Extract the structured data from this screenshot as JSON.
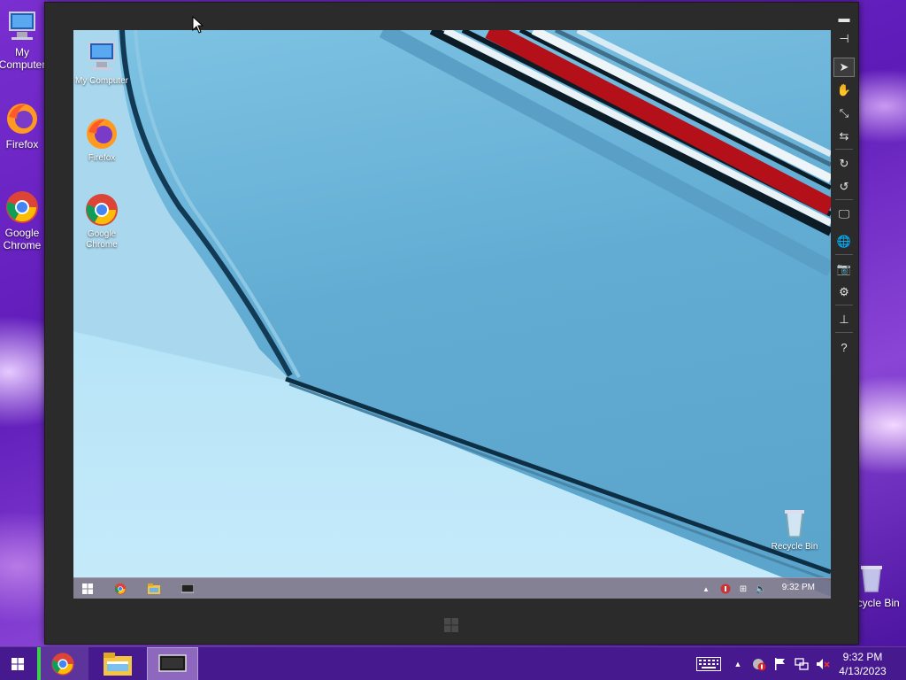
{
  "host": {
    "desktop_icons": [
      {
        "label": "My Computer",
        "icon": "computer-icon"
      },
      {
        "label": "Firefox",
        "icon": "firefox-icon"
      },
      {
        "label": "Google Chrome",
        "icon": "chrome-icon"
      },
      {
        "label": "Recycle Bin",
        "icon": "recycle-bin-icon"
      }
    ],
    "taskbar": {
      "apps": [
        {
          "name": "Google Chrome",
          "icon": "chrome-icon"
        },
        {
          "name": "File Explorer",
          "icon": "folder-icon"
        },
        {
          "name": "Remote Viewer",
          "icon": "monitor-icon"
        }
      ],
      "tray_icons": [
        "keyboard-icon",
        "show-hidden-icons-arrow",
        "security-icon",
        "flag-icon",
        "network-icon",
        "volume-muted-icon"
      ],
      "time": "9:32 PM",
      "date": "4/13/2023"
    }
  },
  "viewer": {
    "toolbar": [
      {
        "name": "minimize",
        "icon": "minimize-icon",
        "glyph": "▬"
      },
      {
        "name": "pin",
        "icon": "pin-icon",
        "glyph": "⊣"
      },
      {
        "name": "select",
        "icon": "cursor-icon",
        "glyph": "➤"
      },
      {
        "name": "pan",
        "icon": "hand-icon",
        "glyph": "✋"
      },
      {
        "name": "fit",
        "icon": "shrink-icon",
        "glyph": "⤡"
      },
      {
        "name": "swap",
        "icon": "swap-icon",
        "glyph": "⇆"
      },
      {
        "name": "rotate-right",
        "icon": "rotate-right-icon",
        "glyph": "↻"
      },
      {
        "name": "rotate-left",
        "icon": "rotate-left-icon",
        "glyph": "↺"
      },
      {
        "name": "display",
        "icon": "monitor-icon",
        "glyph": "🖵"
      },
      {
        "name": "web",
        "icon": "globe-icon",
        "glyph": "🌐"
      },
      {
        "name": "screenshot",
        "icon": "camera-icon",
        "glyph": "📷"
      },
      {
        "name": "settings",
        "icon": "gear-icon",
        "glyph": "⚙"
      },
      {
        "name": "network",
        "icon": "network-icon",
        "glyph": "⊥"
      },
      {
        "name": "help",
        "icon": "help-icon",
        "glyph": "?"
      }
    ]
  },
  "remote": {
    "desktop_icons": [
      {
        "label": "My Computer",
        "icon": "computer-icon"
      },
      {
        "label": "Firefox",
        "icon": "firefox-icon"
      },
      {
        "label": "Google Chrome",
        "icon": "chrome-icon"
      },
      {
        "label": "Recycle Bin",
        "icon": "recycle-bin-icon"
      }
    ],
    "taskbar": {
      "items": [
        "windows-start-icon",
        "chrome-icon",
        "folder-icon",
        "monitor-icon"
      ],
      "tray_icons": [
        "show-hidden-icons-arrow",
        "security-icon",
        "network-icon",
        "volume-icon"
      ],
      "time": "9:32 PM"
    }
  }
}
